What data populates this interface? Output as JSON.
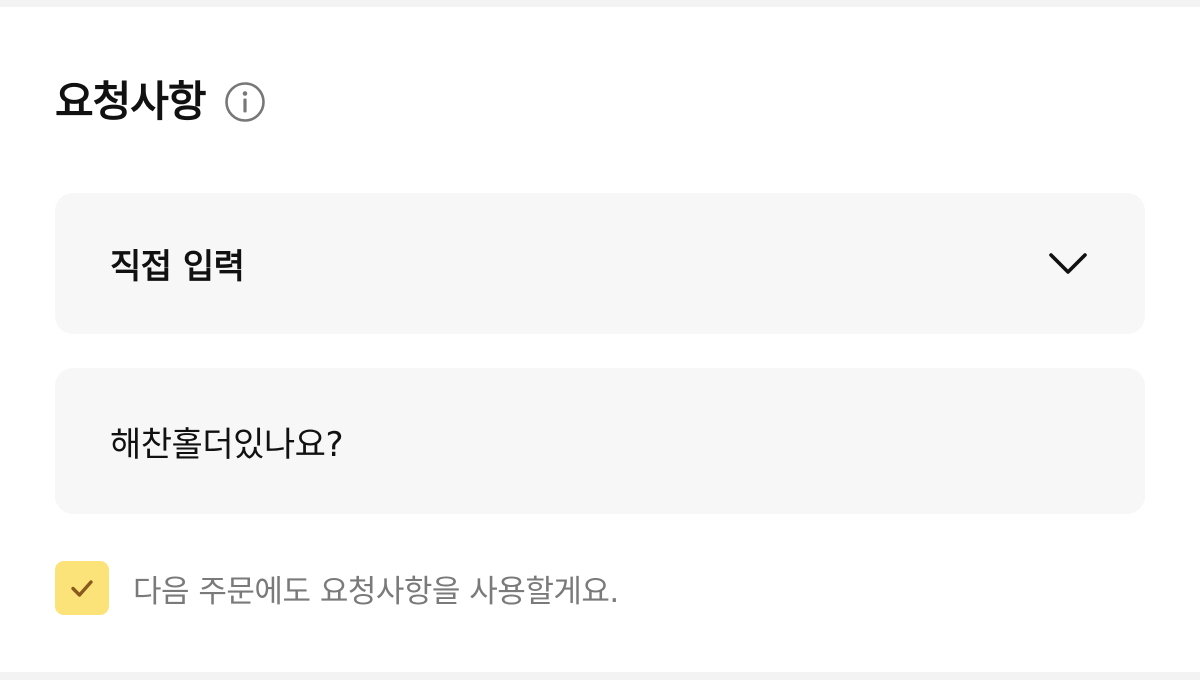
{
  "section": {
    "title": "요청사항"
  },
  "request_type": {
    "selected": "직접 입력"
  },
  "request_input": {
    "value": "해찬홀더있나요?"
  },
  "save_option": {
    "checked": true,
    "label": "다음 주문에도 요청사항을 사용할게요."
  },
  "icons": {
    "info": "info-icon",
    "dropdown": "chevron-down-icon",
    "check": "checkmark-icon"
  },
  "colors": {
    "checkbox_fill": "#fbe37a",
    "checkmark": "#8a5a1c",
    "field_background": "#f7f7f7",
    "muted_text": "#7a7a7a"
  }
}
